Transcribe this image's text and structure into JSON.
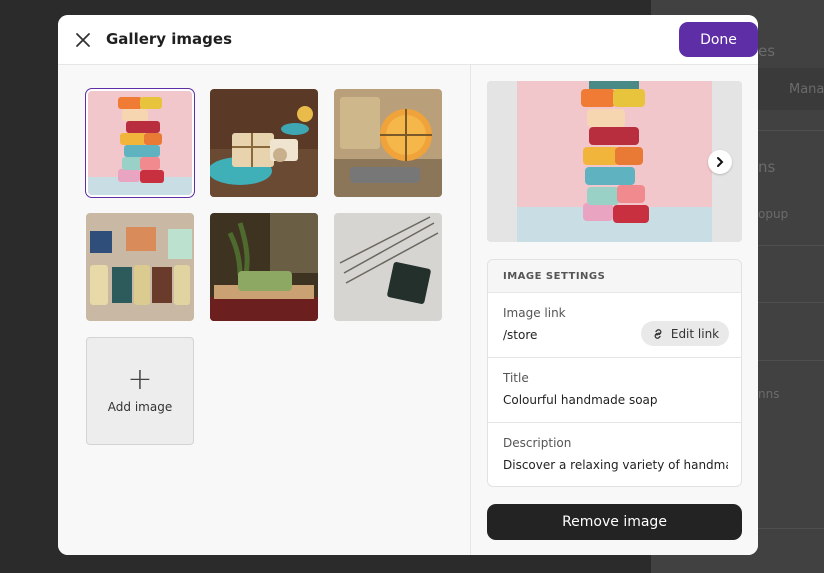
{
  "modal": {
    "title": "Gallery images",
    "done_label": "Done"
  },
  "gallery": {
    "add_image_label": "Add image",
    "images": [
      {
        "subject": "stacked colourful soap bars",
        "selected": true
      },
      {
        "subject": "wrapped soap with blue salts",
        "selected": false
      },
      {
        "subject": "orange soap tied with string",
        "selected": false
      },
      {
        "subject": "soap bars with small bottles",
        "selected": false
      },
      {
        "subject": "green soap bar on wooden tray",
        "selected": false
      },
      {
        "subject": "dark soap with twigs",
        "selected": false
      }
    ]
  },
  "settings": {
    "heading": "IMAGE SETTINGS",
    "image_link_label": "Image link",
    "image_link_value": "/store",
    "edit_link_label": "Edit link",
    "title_label": "Title",
    "title_value": "Colourful handmade soap",
    "description_label": "Description",
    "description_value": "Discover a relaxing variety of handma",
    "remove_label": "Remove image"
  },
  "background": {
    "fragments": [
      "es",
      "Mana",
      "ns",
      "opup",
      "nns"
    ]
  },
  "colors": {
    "accent": "#5e2ea6",
    "dark_button": "#232323"
  }
}
